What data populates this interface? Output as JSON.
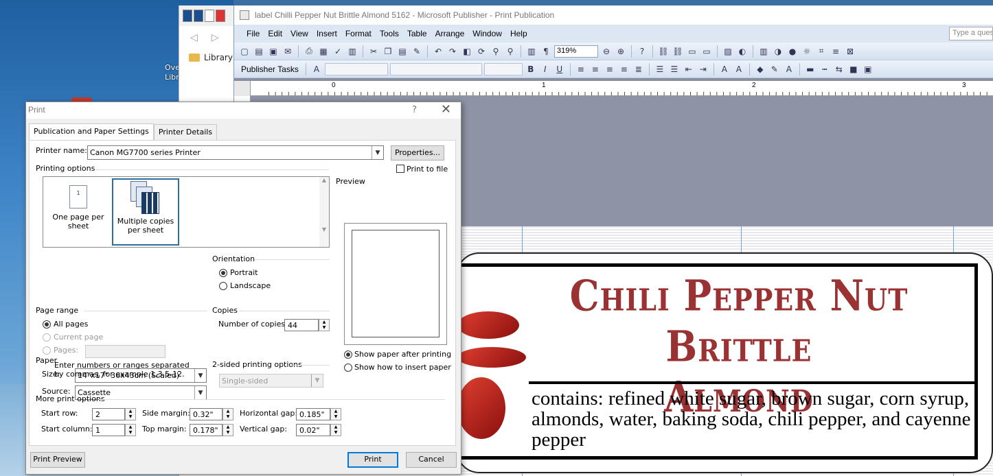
{
  "desktop": {
    "icon_text": "Ove Libr"
  },
  "explorer": {
    "library_label": "Library",
    "back_glyph": "◁",
    "forward_glyph": "▷"
  },
  "publisher": {
    "title": "label Chilli Pepper Nut Brittle Almond 5162 - Microsoft Publisher - Print Publication",
    "menu": [
      "File",
      "Edit",
      "View",
      "Insert",
      "Format",
      "Tools",
      "Table",
      "Arrange",
      "Window",
      "Help"
    ],
    "help_placeholder": "Type a question for help",
    "zoom": "319%",
    "publisher_tasks": "Publisher Tasks",
    "ruler_numbers": [
      "0",
      "1",
      "2",
      "3"
    ]
  },
  "label": {
    "title_line1": "Chili Pepper Nut Brittle",
    "title_line2": "Almond",
    "contents": "contains: refined white sugar, brown sugar, corn syrup, almonds, water, baking soda, chili pepper, and cayenne pepper",
    "title_color": "#9a3233"
  },
  "dialog": {
    "title": "Print",
    "help_glyph": "?",
    "close_glyph": "✕",
    "tabs": [
      "Publication and Paper Settings",
      "Printer Details"
    ],
    "printer_name_label": "Printer name:",
    "printer_name": "Canon MG7700 series Printer",
    "properties_button": "Properties...",
    "print_to_file": "Print to file",
    "printing_options_label": "Printing options",
    "option_one": "One page per sheet",
    "option_multiple": "Multiple copies per sheet",
    "preview_label": "Preview",
    "paper_label": "Paper",
    "size_label": "Size:",
    "size_value": "14\"x17\" 36x43cm (Scaled)",
    "source_label": "Source:",
    "source_value": "Cassette",
    "orientation_label": "Orientation",
    "portrait": "Portrait",
    "landscape": "Landscape",
    "show_paper": "Show paper after printing",
    "show_insert": "Show how to insert paper",
    "page_range_label": "Page range",
    "all_pages": "All pages",
    "current_page": "Current page",
    "pages": "Pages:",
    "pages_hint": "Enter numbers or ranges separated by commas, for example 1,3,5-12.",
    "copies_label": "Copies",
    "number_of_copies_label": "Number of copies:",
    "number_of_copies": "44",
    "two_sided_label": "2-sided printing options",
    "two_sided_value": "Single-sided",
    "more_options_label": "More print options",
    "start_row_label": "Start row:",
    "start_row": "2",
    "start_column_label": "Start column:",
    "start_column": "1",
    "side_margin_label": "Side margin:",
    "side_margin": "0.32\"",
    "top_margin_label": "Top margin:",
    "top_margin": "0.178\"",
    "horizontal_gap_label": "Horizontal gap:",
    "horizontal_gap": "0.185\"",
    "vertical_gap_label": "Vertical gap:",
    "vertical_gap": "0.02\"",
    "print_preview_button": "Print Preview",
    "print_button": "Print",
    "cancel_button": "Cancel"
  }
}
